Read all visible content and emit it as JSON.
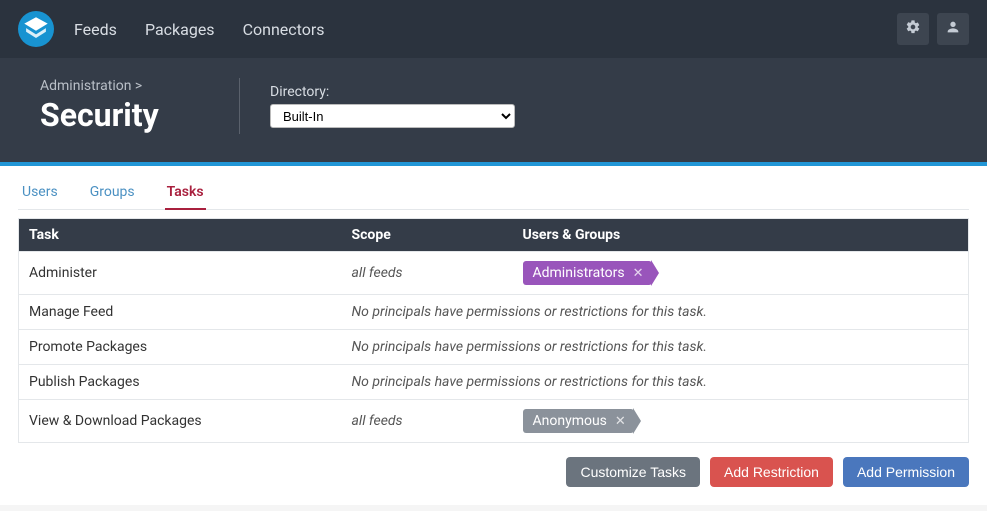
{
  "nav": {
    "links": [
      "Feeds",
      "Packages",
      "Connectors"
    ]
  },
  "header": {
    "breadcrumb": "Administration >",
    "title": "Security",
    "directory_label": "Directory:",
    "directory_value": "Built-In"
  },
  "tabs": [
    {
      "label": "Users",
      "active": false
    },
    {
      "label": "Groups",
      "active": false
    },
    {
      "label": "Tasks",
      "active": true
    }
  ],
  "table": {
    "headers": {
      "task": "Task",
      "scope": "Scope",
      "ug": "Users & Groups"
    },
    "empty_msg": "No principals have permissions or restrictions for this task.",
    "rows": [
      {
        "task": "Administer",
        "scope": "all feeds",
        "tags": [
          {
            "label": "Administrators",
            "color": "purple"
          }
        ]
      },
      {
        "task": "Manage Feed",
        "empty": true
      },
      {
        "task": "Promote Packages",
        "empty": true
      },
      {
        "task": "Publish Packages",
        "empty": true
      },
      {
        "task": "View & Download Packages",
        "scope": "all feeds",
        "tags": [
          {
            "label": "Anonymous",
            "color": "gray"
          }
        ]
      }
    ]
  },
  "buttons": {
    "customize": "Customize Tasks",
    "add_restriction": "Add Restriction",
    "add_permission": "Add Permission"
  },
  "colors": {
    "accent": "#2196d6",
    "tag_purple": "#9955bb",
    "tag_gray": "#8b929b",
    "btn_red": "#d9534f",
    "btn_blue": "#4a77bd"
  }
}
